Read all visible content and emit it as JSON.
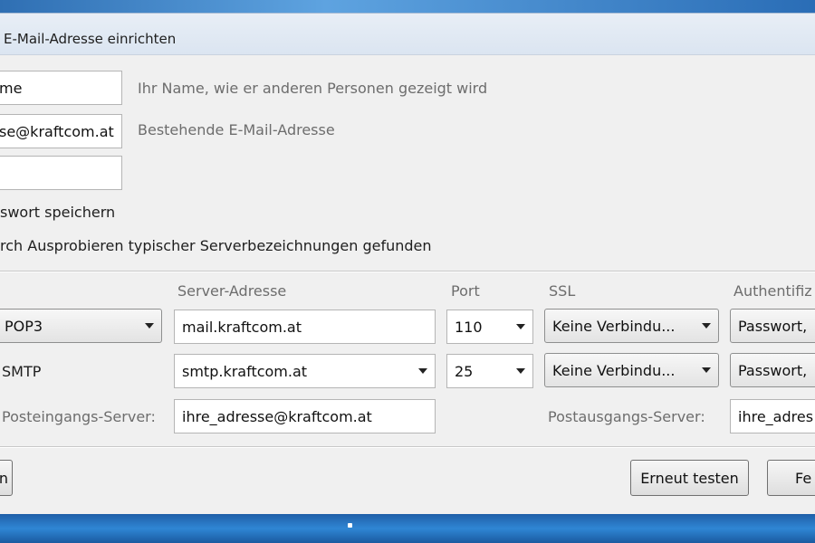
{
  "window": {
    "title": "E-Mail-Adresse einrichten"
  },
  "form": {
    "name_value": "me",
    "name_hint": "Ihr Name, wie er anderen Personen gezeigt wird",
    "email_value": "se@kraftcom.at",
    "email_hint": "Bestehende E-Mail-Adresse",
    "password_value": "",
    "remember_password_label": "swort speichern",
    "status_text": "rch Ausprobieren typischer Serverbezeichnungen gefunden"
  },
  "server_table": {
    "headers": {
      "server_address": "Server-Adresse",
      "port": "Port",
      "ssl": "SSL",
      "auth": "Authentifiz"
    },
    "incoming": {
      "protocol": "POP3",
      "server": "mail.kraftcom.at",
      "port": "110",
      "ssl": "Keine Verbindu...",
      "auth": "Passwort,"
    },
    "outgoing": {
      "protocol": "SMTP",
      "server": "smtp.kraftcom.at",
      "port": "25",
      "ssl": "Keine Verbindu...",
      "auth": "Passwort,"
    },
    "incoming_user_label": "Posteingangs-Server:",
    "incoming_user_value": "ihre_adresse@kraftcom.at",
    "outgoing_user_label": "Postausgangs-Server:",
    "outgoing_user_value": "ihre_adres"
  },
  "buttons": {
    "left_partial": "n",
    "retest": "Erneut testen",
    "right_partial": "Fe"
  }
}
